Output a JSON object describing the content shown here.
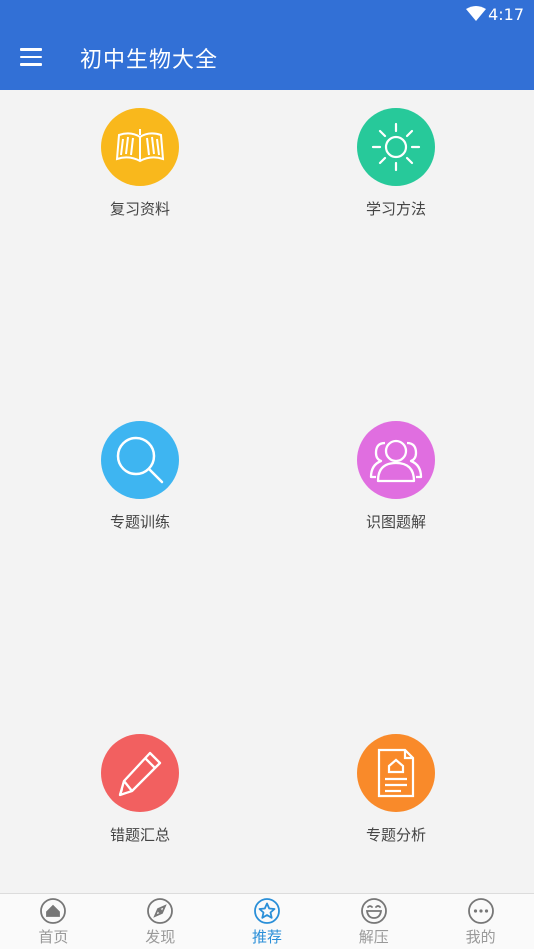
{
  "status_bar": {
    "time": "4:17"
  },
  "header": {
    "title": "初中生物大全"
  },
  "grid": [
    {
      "label": "复习资料",
      "icon": "book-icon",
      "color": "#f9b81c"
    },
    {
      "label": "学习方法",
      "icon": "sun-icon",
      "color": "#27c99a"
    },
    {
      "label": "专题训练",
      "icon": "search-icon",
      "color": "#3eb5f1"
    },
    {
      "label": "识图题解",
      "icon": "users-icon",
      "color": "#e06ee0"
    },
    {
      "label": "错题汇总",
      "icon": "pencil-icon",
      "color": "#f26060"
    },
    {
      "label": "专题分析",
      "icon": "document-icon",
      "color": "#f98a2a"
    }
  ],
  "bottom_nav": [
    {
      "label": "首页",
      "icon": "home-icon",
      "active": false
    },
    {
      "label": "发现",
      "icon": "compass-icon",
      "active": false
    },
    {
      "label": "推荐",
      "icon": "star-icon",
      "active": true
    },
    {
      "label": "解压",
      "icon": "smile-icon",
      "active": false
    },
    {
      "label": "我的",
      "icon": "more-icon",
      "active": false
    }
  ],
  "colors": {
    "appbar": "#3270d6",
    "background": "#f3f3f3",
    "active_tab": "#2a8fd8"
  }
}
